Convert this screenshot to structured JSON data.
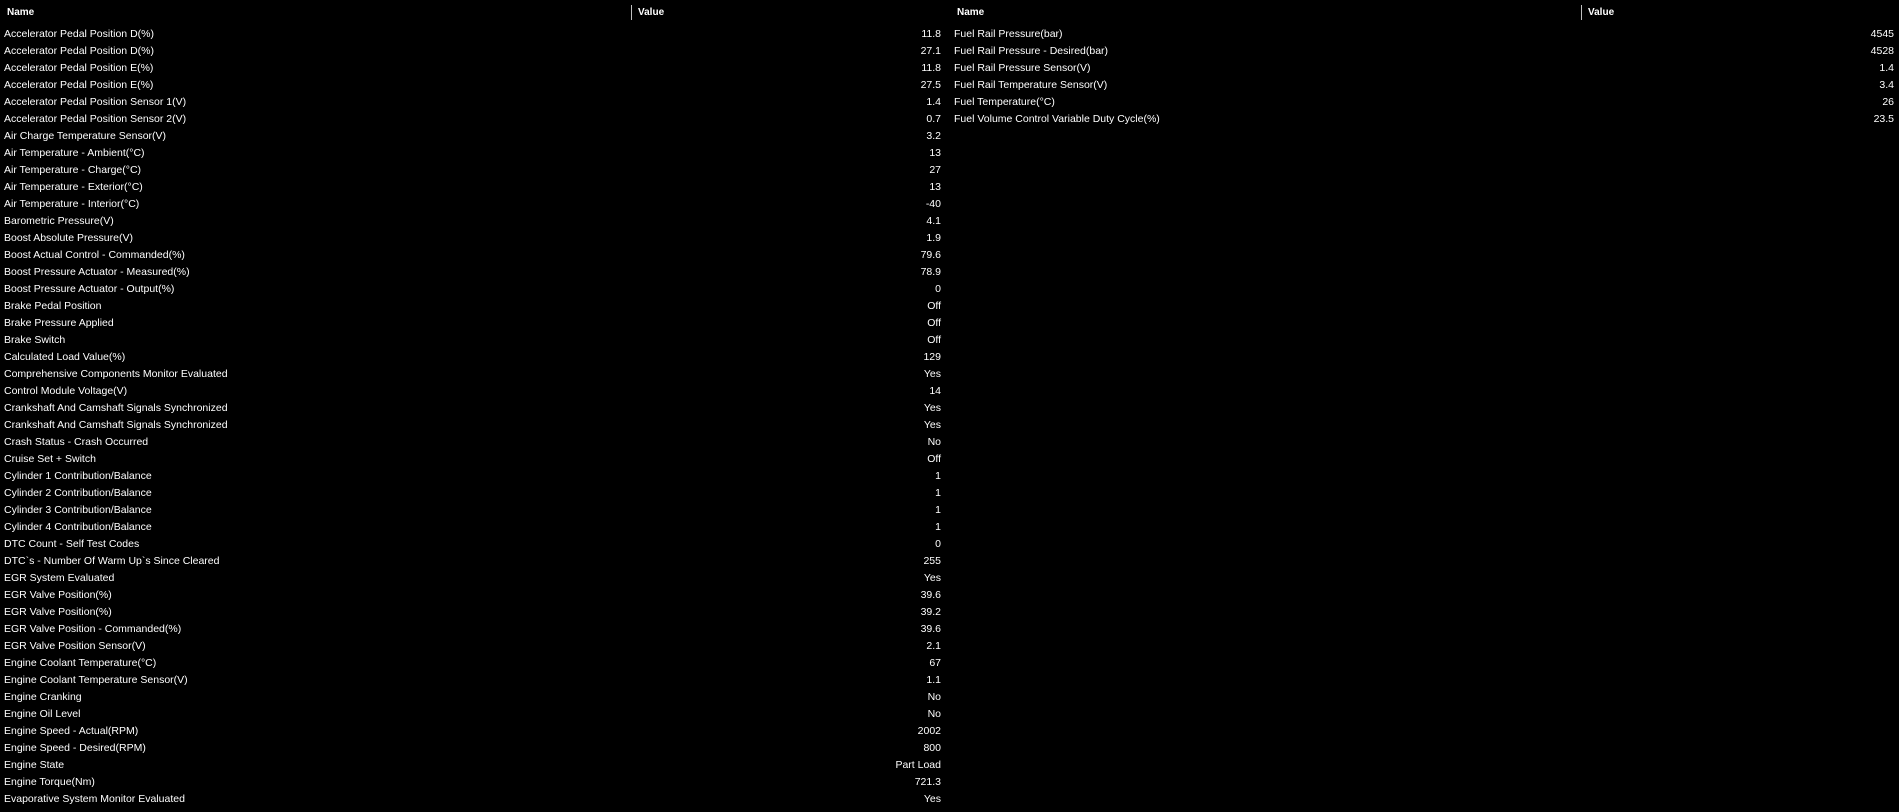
{
  "left_table": {
    "header": {
      "name": "Name",
      "value": "Value"
    },
    "rows": [
      {
        "name": "Accelerator Pedal Position D(%)",
        "value": "11.8"
      },
      {
        "name": "Accelerator Pedal Position D(%)",
        "value": "27.1"
      },
      {
        "name": "Accelerator Pedal Position E(%)",
        "value": "11.8"
      },
      {
        "name": "Accelerator Pedal Position E(%)",
        "value": "27.5"
      },
      {
        "name": "Accelerator Pedal Position Sensor 1(V)",
        "value": "1.4"
      },
      {
        "name": "Accelerator Pedal Position Sensor 2(V)",
        "value": "0.7"
      },
      {
        "name": "Air Charge Temperature Sensor(V)",
        "value": "3.2"
      },
      {
        "name": "Air Temperature - Ambient(°C)",
        "value": "13"
      },
      {
        "name": "Air Temperature - Charge(°C)",
        "value": "27"
      },
      {
        "name": "Air Temperature - Exterior(°C)",
        "value": "13"
      },
      {
        "name": "Air Temperature - Interior(°C)",
        "value": "-40"
      },
      {
        "name": "Barometric Pressure(V)",
        "value": "4.1"
      },
      {
        "name": "Boost Absolute Pressure(V)",
        "value": "1.9"
      },
      {
        "name": "Boost Actual Control - Commanded(%)",
        "value": "79.6"
      },
      {
        "name": "Boost Pressure Actuator - Measured(%)",
        "value": "78.9"
      },
      {
        "name": "Boost Pressure Actuator - Output(%)",
        "value": "0"
      },
      {
        "name": "Brake Pedal Position",
        "value": "Off"
      },
      {
        "name": "Brake Pressure Applied",
        "value": "Off"
      },
      {
        "name": "Brake Switch",
        "value": "Off"
      },
      {
        "name": "Calculated Load Value(%)",
        "value": "129"
      },
      {
        "name": "Comprehensive Components Monitor Evaluated",
        "value": "Yes"
      },
      {
        "name": "Control Module Voltage(V)",
        "value": "14"
      },
      {
        "name": "Crankshaft And Camshaft Signals Synchronized",
        "value": "Yes"
      },
      {
        "name": "Crankshaft And Camshaft Signals Synchronized",
        "value": "Yes"
      },
      {
        "name": "Crash Status - Crash Occurred",
        "value": "No"
      },
      {
        "name": "Cruise Set + Switch",
        "value": "Off"
      },
      {
        "name": "Cylinder 1 Contribution/Balance",
        "value": "1"
      },
      {
        "name": "Cylinder 2 Contribution/Balance",
        "value": "1"
      },
      {
        "name": "Cylinder 3 Contribution/Balance",
        "value": "1"
      },
      {
        "name": "Cylinder 4 Contribution/Balance",
        "value": "1"
      },
      {
        "name": "DTC Count - Self Test Codes",
        "value": "0"
      },
      {
        "name": "DTC`s - Number Of Warm Up`s Since Cleared",
        "value": "255"
      },
      {
        "name": "EGR System Evaluated",
        "value": "Yes"
      },
      {
        "name": "EGR Valve Position(%)",
        "value": "39.6"
      },
      {
        "name": "EGR Valve Position(%)",
        "value": "39.2"
      },
      {
        "name": "EGR Valve Position - Commanded(%)",
        "value": "39.6"
      },
      {
        "name": "EGR Valve Position Sensor(V)",
        "value": "2.1"
      },
      {
        "name": "Engine Coolant Temperature(°C)",
        "value": "67"
      },
      {
        "name": "Engine Coolant Temperature Sensor(V)",
        "value": "1.1"
      },
      {
        "name": "Engine Cranking",
        "value": "No"
      },
      {
        "name": "Engine Oil Level",
        "value": "No"
      },
      {
        "name": "Engine Speed - Actual(RPM)",
        "value": "2002"
      },
      {
        "name": "Engine Speed - Desired(RPM)",
        "value": "800"
      },
      {
        "name": "Engine State",
        "value": "Part Load"
      },
      {
        "name": "Engine Torque(Nm)",
        "value": "721.3"
      },
      {
        "name": "Evaporative System Monitor Evaluated",
        "value": "Yes"
      }
    ]
  },
  "right_table": {
    "header": {
      "name": "Name",
      "value": "Value"
    },
    "rows": [
      {
        "name": "Fuel Rail Pressure(bar)",
        "value": "4545"
      },
      {
        "name": "Fuel Rail Pressure - Desired(bar)",
        "value": "4528"
      },
      {
        "name": "Fuel Rail Pressure Sensor(V)",
        "value": "1.4"
      },
      {
        "name": "Fuel Rail Temperature Sensor(V)",
        "value": "3.4"
      },
      {
        "name": "Fuel Temperature(°C)",
        "value": "26"
      },
      {
        "name": "Fuel Volume Control Variable Duty Cycle(%)",
        "value": "23.5"
      }
    ]
  }
}
